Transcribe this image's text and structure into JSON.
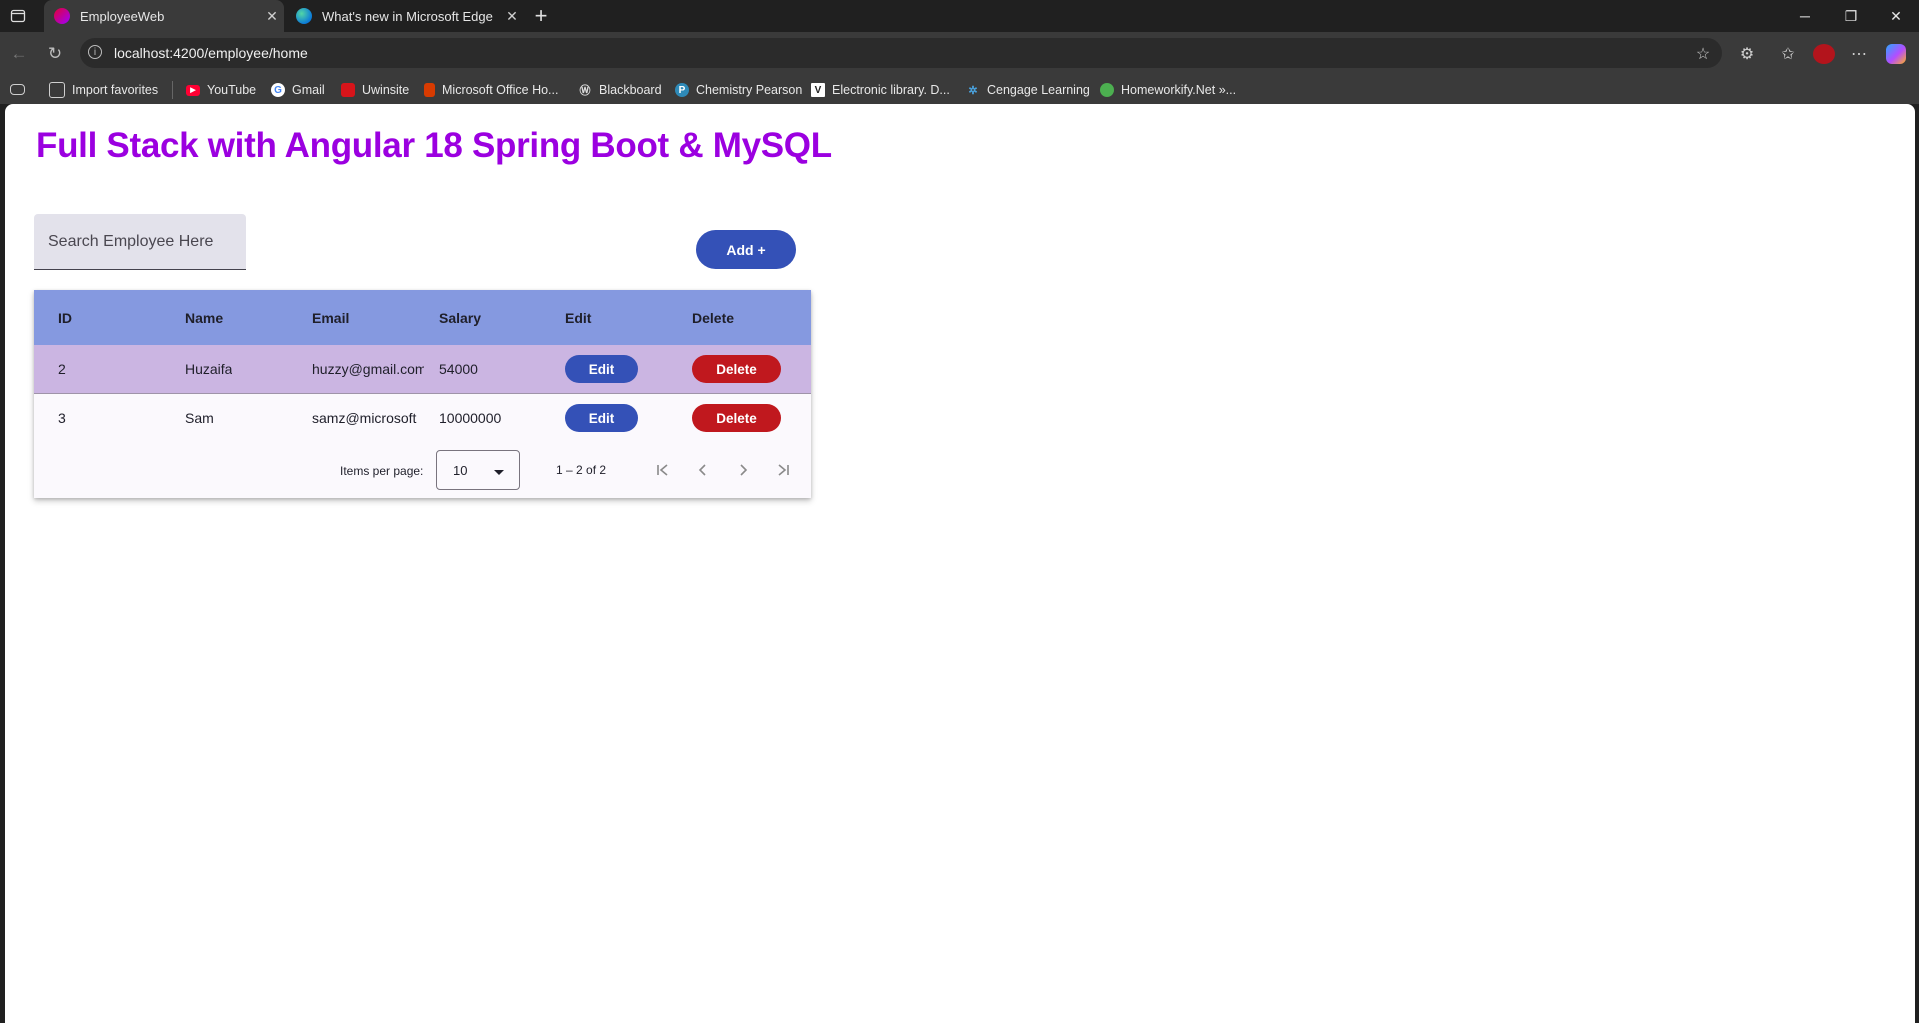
{
  "browser": {
    "tabs": [
      {
        "title": "EmployeeWeb"
      },
      {
        "title": "What's new in Microsoft Edge"
      }
    ],
    "new_tab_label": "+",
    "url": "localhost:4200/employee/home",
    "bookmarks": [
      {
        "label": "Import favorites",
        "icon": "folder-icon"
      },
      {
        "label": "YouTube",
        "icon": "youtube-icon"
      },
      {
        "label": "Gmail",
        "icon": "google-icon"
      },
      {
        "label": "Uwinsite",
        "icon": "uwinsite-icon"
      },
      {
        "label": "Microsoft Office Ho...",
        "icon": "office-icon"
      },
      {
        "label": "Blackboard",
        "icon": "blackboard-icon"
      },
      {
        "label": "Chemistry Pearson",
        "icon": "pearson-icon"
      },
      {
        "label": "Electronic library. D...",
        "icon": "library-icon"
      },
      {
        "label": "Cengage Learning",
        "icon": "cengage-icon"
      },
      {
        "label": "Homeworkify.Net »...",
        "icon": "homeworkify-icon"
      }
    ]
  },
  "page": {
    "title": "Full Stack with Angular 18 Spring Boot & MySQL",
    "search_placeholder": "Search Employee Here",
    "add_label": "Add +"
  },
  "table": {
    "columns": [
      "ID",
      "Name",
      "Email",
      "Salary",
      "Edit",
      "Delete"
    ],
    "rows": [
      {
        "id": "2",
        "name": "Huzaifa",
        "email": "huzzy@gmail.com",
        "salary": "54000",
        "edit": "Edit",
        "delete": "Delete"
      },
      {
        "id": "3",
        "name": "Sam",
        "email": "samz@microsoft",
        "salary": "10000000",
        "edit": "Edit",
        "delete": "Delete"
      }
    ]
  },
  "paginator": {
    "items_per_page_label": "Items per page:",
    "items_per_page_value": "10",
    "range_label": "1 – 2 of 2"
  },
  "colors": {
    "title": "#9b00e0",
    "primary": "#3451b7",
    "danger": "#c0181e",
    "header_row": "#8599e0",
    "highlight_row": "#cbb5e2"
  }
}
